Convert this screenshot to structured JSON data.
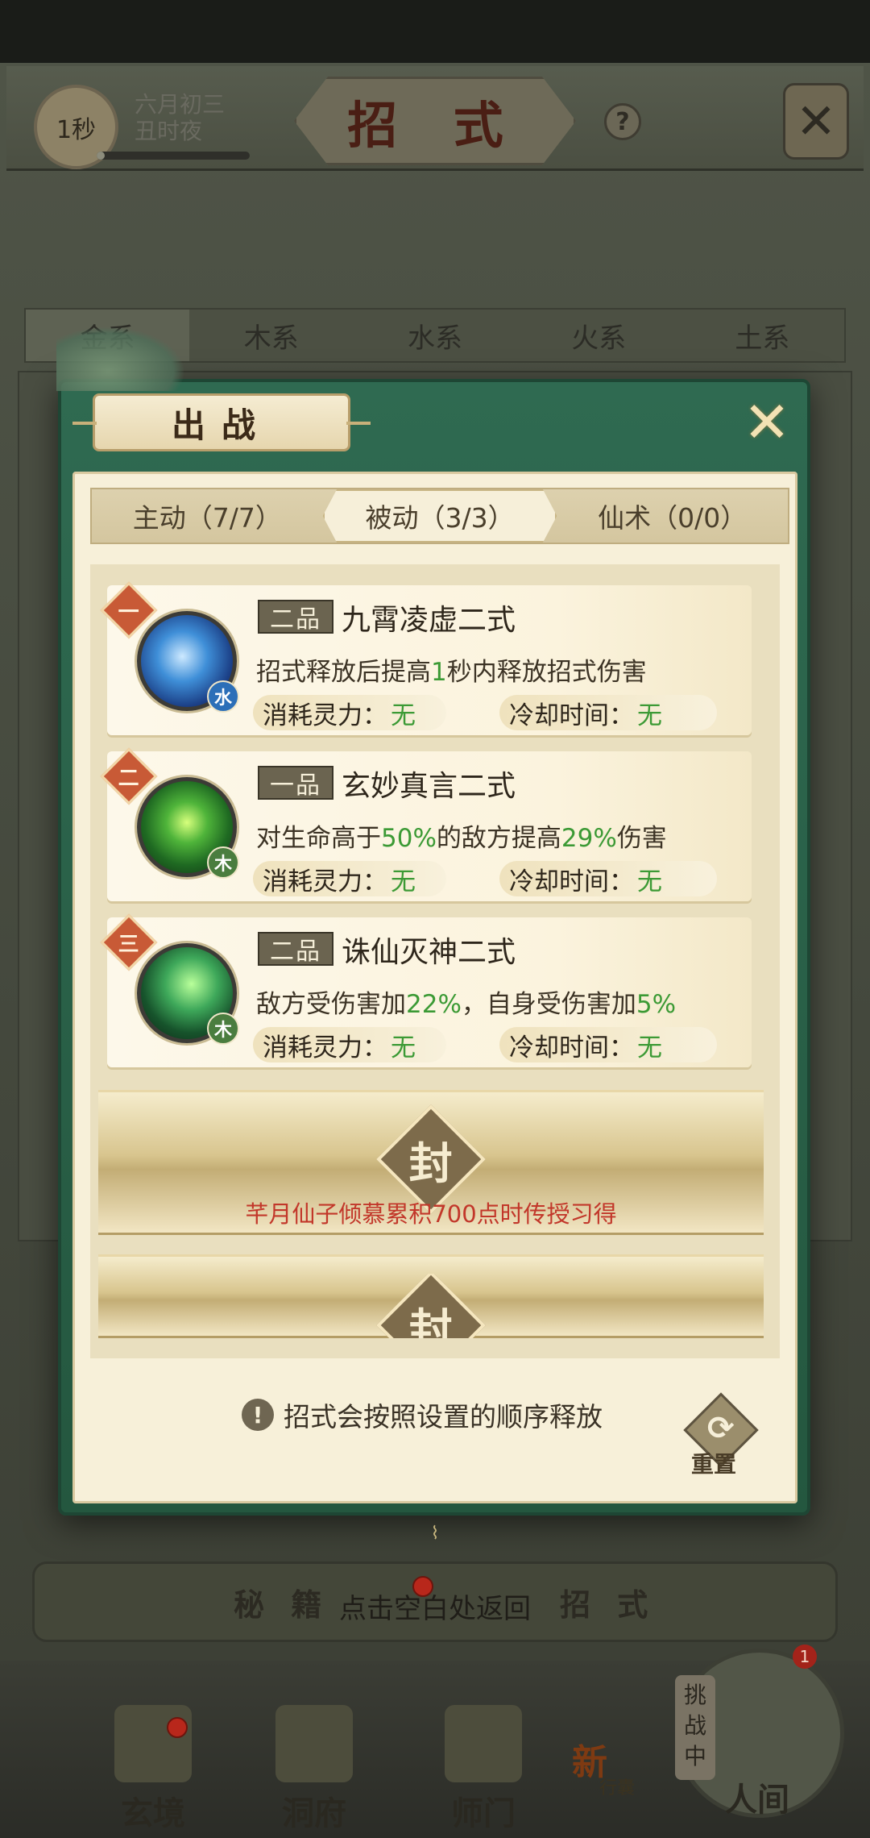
{
  "header": {
    "timer": "1秒",
    "timer_progress": 0.05,
    "date_line1": "六月初三",
    "date_line2": "丑时夜",
    "title": "招 式",
    "help_glyph": "?",
    "close_glyph": "✕"
  },
  "element_tabs": [
    "金系",
    "木系",
    "水系",
    "火系",
    "土系"
  ],
  "modal": {
    "title": "出战",
    "close_glyph": "✕",
    "mode_tabs": [
      {
        "label": "主动（7/7）",
        "active": false
      },
      {
        "label": "被动（3/3）",
        "active": true
      },
      {
        "label": "仙术（0/0）",
        "active": false
      }
    ],
    "skills": [
      {
        "slot": "一",
        "grade": "二品",
        "name": "九霄凌虚二式",
        "element": "水",
        "desc_parts": [
          "招式释放后提高",
          "1",
          "秒内释放招式伤害"
        ],
        "cost_label": "消耗灵力：",
        "cost_value": "无",
        "cooldown_label": "冷却时间：",
        "cooldown_value": "无"
      },
      {
        "slot": "二",
        "grade": "一品",
        "name": "玄妙真言二式",
        "element": "木",
        "desc_parts": [
          "对生命高于",
          "50%",
          "的敌方提高",
          "29%",
          "伤害"
        ],
        "cost_label": "消耗灵力：",
        "cost_value": "无",
        "cooldown_label": "冷却时间：",
        "cooldown_value": "无"
      },
      {
        "slot": "三",
        "grade": "二品",
        "name": "诛仙灭神二式",
        "element": "木",
        "desc_parts": [
          "敌方受伤害加",
          "22%",
          "，自身受伤害加",
          "5%"
        ],
        "cost_label": "消耗灵力：",
        "cost_value": "无",
        "cooldown_label": "冷却时间：",
        "cooldown_value": "无"
      }
    ],
    "sealed_slots": [
      {
        "glyph": "封",
        "hint": "芊月仙子倾慕累积700点时传授习得"
      },
      {
        "glyph": "封",
        "hint": ""
      }
    ],
    "footer_note": "招式会按照设置的顺序释放",
    "note_icon_glyph": "!",
    "reset_glyph": "⟳",
    "reset_label": "重置"
  },
  "back_bar": {
    "left_tab": "秘 籍",
    "hint": "点击空白处返回",
    "right_tab": "招 式"
  },
  "nav": {
    "items": [
      "玄境",
      "洞府",
      "师门",
      "人间"
    ],
    "new_badge": "新",
    "new_sub": "行囊",
    "challenge_text": "挑战中",
    "challenge_count": "1"
  },
  "colors": {
    "modal_green": "#2f6a51",
    "paper": "#f7f0d9",
    "highlight_green": "#3c9a35",
    "seal_hint_red": "#c2372a",
    "slot_badge": "#c85a36"
  }
}
